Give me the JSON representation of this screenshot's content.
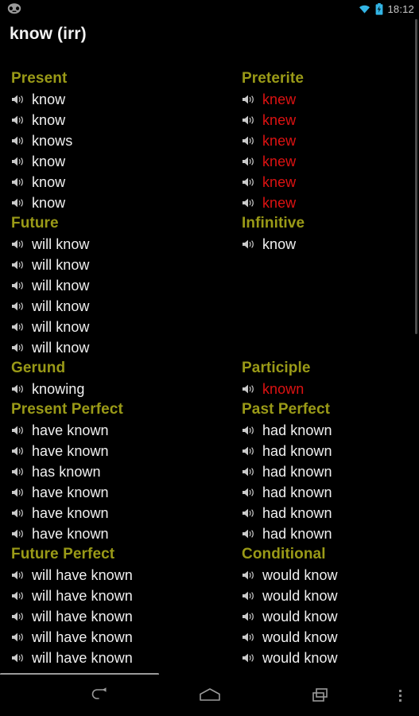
{
  "statusbar": {
    "logo_icon": "cyanogenmod-logo-icon",
    "wifi_icon": "wifi-icon",
    "battery_icon": "battery-charging-icon",
    "clock": "18:12",
    "accent_color": "#33b5e5",
    "clock_color": "#c8c8c8"
  },
  "header": {
    "title": "know (irr)"
  },
  "theme": {
    "background": "#000000",
    "header_color": "#9a9a17",
    "text_color": "#f0f0f0",
    "irregular_color": "#dd1212",
    "speaker_icon_color": "#c9c9c9"
  },
  "speak_icon": "speaker-icon",
  "columns": {
    "left": [
      {
        "header": "Present",
        "rows": [
          {
            "form": "know",
            "irregular": false
          },
          {
            "form": "know",
            "irregular": false
          },
          {
            "form": "knows",
            "irregular": false
          },
          {
            "form": "know",
            "irregular": false
          },
          {
            "form": "know",
            "irregular": false
          },
          {
            "form": "know",
            "irregular": false
          }
        ]
      },
      {
        "header": "Future",
        "rows": [
          {
            "form": "will know",
            "irregular": false
          },
          {
            "form": "will know",
            "irregular": false
          },
          {
            "form": "will know",
            "irregular": false
          },
          {
            "form": "will know",
            "irregular": false
          },
          {
            "form": "will know",
            "irregular": false
          },
          {
            "form": "will know",
            "irregular": false
          }
        ]
      },
      {
        "header": "Gerund",
        "rows": [
          {
            "form": "knowing",
            "irregular": false
          }
        ]
      },
      {
        "header": "Present Perfect",
        "rows": [
          {
            "form": "have known",
            "irregular": false
          },
          {
            "form": "have known",
            "irregular": false
          },
          {
            "form": "has known",
            "irregular": false
          },
          {
            "form": "have known",
            "irregular": false
          },
          {
            "form": "have known",
            "irregular": false
          },
          {
            "form": "have known",
            "irregular": false
          }
        ]
      },
      {
        "header": "Future Perfect",
        "rows": [
          {
            "form": "will have known",
            "irregular": false
          },
          {
            "form": "will have known",
            "irregular": false
          },
          {
            "form": "will have known",
            "irregular": false
          },
          {
            "form": "will have known",
            "irregular": false
          },
          {
            "form": "will have known",
            "irregular": false
          }
        ]
      }
    ],
    "right": [
      {
        "header": "Preterite",
        "rows": [
          {
            "form": "knew",
            "irregular": true
          },
          {
            "form": "knew",
            "irregular": true
          },
          {
            "form": "knew",
            "irregular": true
          },
          {
            "form": "knew",
            "irregular": true
          },
          {
            "form": "knew",
            "irregular": true
          },
          {
            "form": "knew",
            "irregular": true
          }
        ]
      },
      {
        "header": "Infinitive",
        "rows": [
          {
            "form": "know",
            "irregular": false
          }
        ],
        "pad_after": 5
      },
      {
        "header": "Participle",
        "rows": [
          {
            "form": "known",
            "irregular": true
          }
        ]
      },
      {
        "header": "Past Perfect",
        "rows": [
          {
            "form": "had known",
            "irregular": false
          },
          {
            "form": "had known",
            "irregular": false
          },
          {
            "form": "had known",
            "irregular": false
          },
          {
            "form": "had known",
            "irregular": false
          },
          {
            "form": "had known",
            "irregular": false
          },
          {
            "form": "had known",
            "irregular": false
          }
        ]
      },
      {
        "header": "Conditional",
        "rows": [
          {
            "form": "would know",
            "irregular": false
          },
          {
            "form": "would know",
            "irregular": false
          },
          {
            "form": "would know",
            "irregular": false
          },
          {
            "form": "would know",
            "irregular": false
          },
          {
            "form": "would know",
            "irregular": false
          }
        ]
      }
    ]
  },
  "navbar": {
    "back_icon": "back-arrow-icon",
    "home_icon": "home-icon",
    "recents_icon": "recent-apps-icon",
    "overflow_icon": "overflow-menu-icon"
  }
}
